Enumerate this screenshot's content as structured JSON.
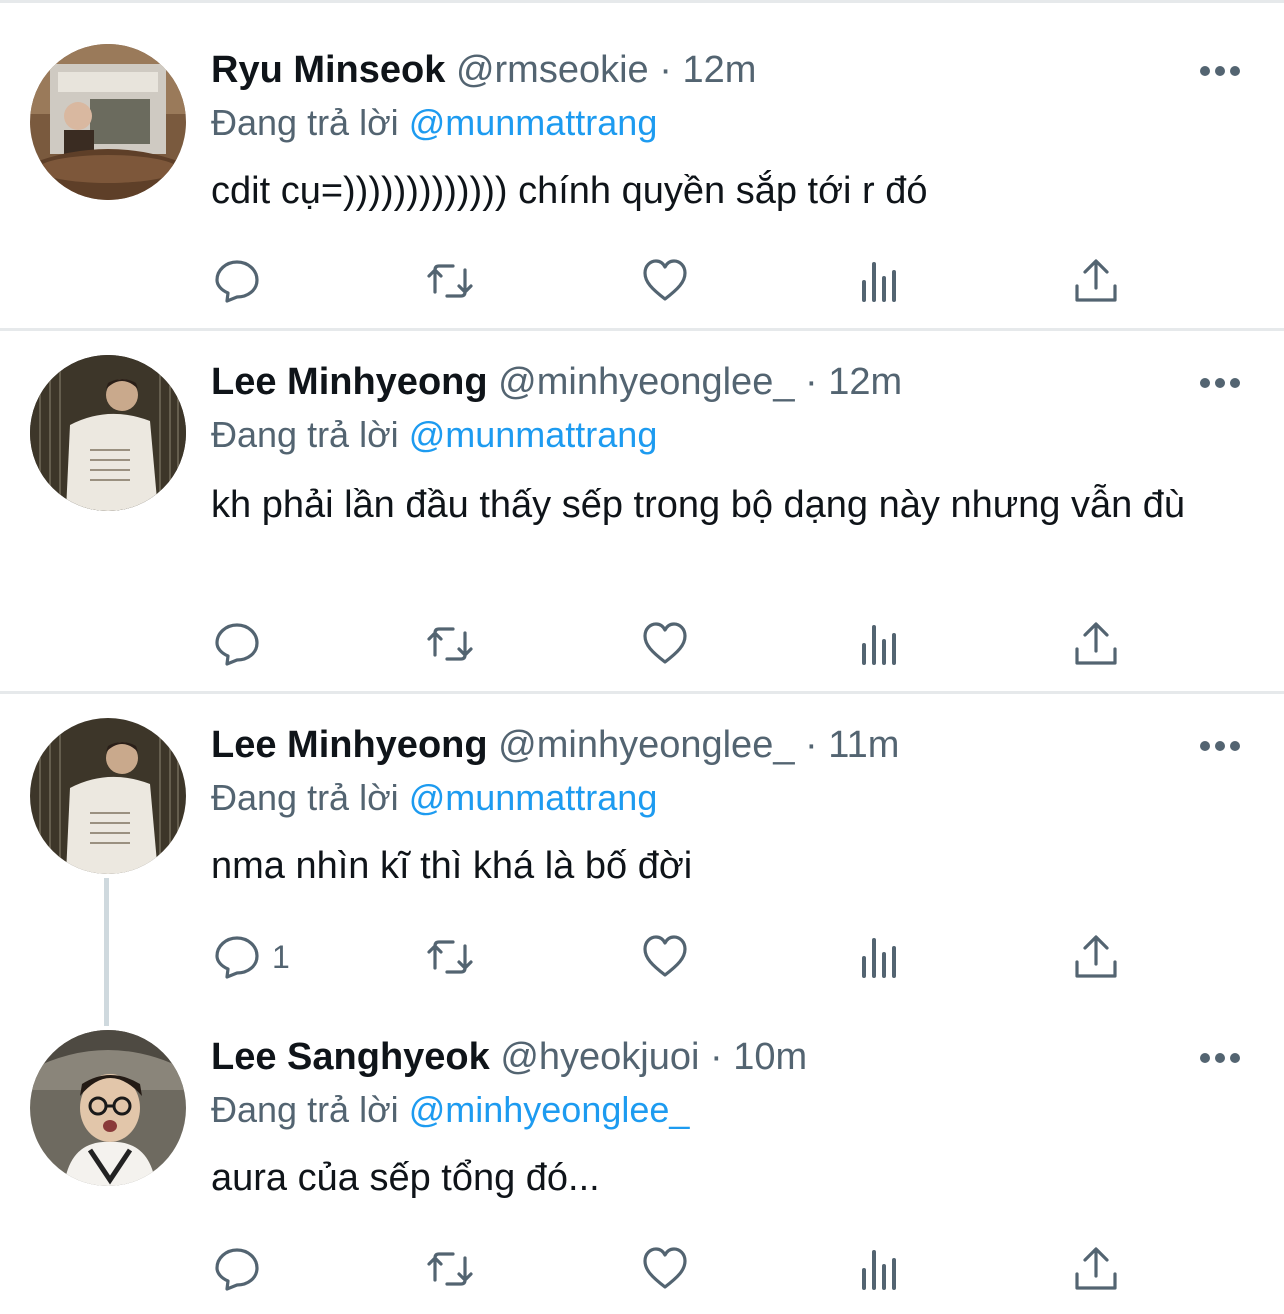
{
  "colors": {
    "accent": "#1d9bf0",
    "secondary_text": "#536471",
    "divider": "#e6e9eb",
    "thread_line": "#cfd9de"
  },
  "icons": {
    "reply": "reply-icon",
    "retweet": "retweet-icon",
    "like": "heart-icon",
    "analytics": "analytics-icon",
    "share": "share-icon",
    "more": "more-options-icon"
  },
  "tweets": [
    {
      "name": "Ryu Minseok",
      "handle": "@rmseokie",
      "separator": "·",
      "time": "12m",
      "reply_prefix": "Đang trả lời",
      "reply_to": "@munmattrang",
      "text": "cdit cụ=))))))))))))) chính quyền sắp tới r đó",
      "reply_count": ""
    },
    {
      "name": "Lee Minhyeong",
      "handle": "@minhyeonglee_",
      "separator": "·",
      "time": "12m",
      "reply_prefix": "Đang trả lời",
      "reply_to": "@munmattrang",
      "text": "kh phải lần đầu thấy sếp trong bộ dạng này nhưng vẫn đù",
      "reply_count": ""
    },
    {
      "name": "Lee Minhyeong",
      "handle": "@minhyeonglee_",
      "separator": "·",
      "time": "11m",
      "reply_prefix": "Đang trả lời",
      "reply_to": "@munmattrang",
      "text": "nma nhìn kĩ thì khá là bố đời",
      "reply_count": "1"
    },
    {
      "name": "Lee Sanghyeok",
      "handle": "@hyeokjuoi",
      "separator": "·",
      "time": "10m",
      "reply_prefix": "Đang trả lời",
      "reply_to": "@minhyeonglee_",
      "text": "aura của sếp tổng đó...",
      "reply_count": ""
    }
  ]
}
